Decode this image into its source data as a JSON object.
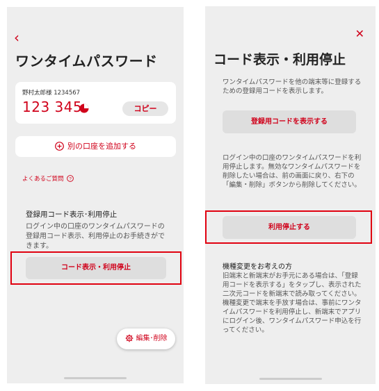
{
  "left": {
    "title": "ワンタイムパスワード",
    "account_name": "野村太郎様 1234567",
    "otp_code": "123 345",
    "copy_label": "コピー",
    "add_account_label": "別の口座を追加する",
    "faq_label": "よくあるご質問",
    "section_title": "登録用コード表示･利用停止",
    "section_desc": "ログイン中の口座のワンタイムパスワードの登録用コード表示、利用停止のお手続きができます。",
    "code_stop_button": "コード表示・利用停止",
    "edit_delete_label": "編集･削除"
  },
  "right": {
    "title": "コード表示・利用停止",
    "desc1": "ワンタイムパスワードを他の端末等に登録するための登録用コードを表示します。",
    "show_code_button": "登録用コードを表示する",
    "desc2": "ログイン中の口座のワンタイムパスワードを利用停止します。無効なワンタイムパスワードを削除したい場合は、前の画面に戻り、右下の「編集・削除」ボタンから削除してください。",
    "stop_button": "利用停止する",
    "section_title": "機種変更をお考えの方",
    "desc3": "旧端末と新端末がお手元にある場合は、「登録用コードを表示する」をタップし、表示された二次元コードを新端末で読み取ってください。機種変更で端末を手放す場合は、事前にワンタイムパスワードを利用停止し、新端末でアプリにログイン後、ワンタイムパスワード申込を行ってください。"
  },
  "icons": {
    "back": "chevron-left-icon",
    "timer": "timer-icon",
    "add": "plus-circle-icon",
    "help": "question-circle-icon",
    "settings": "gear-icon",
    "close": "close-icon"
  },
  "colors": {
    "accent": "#d0021b",
    "highlight_frame": "#e0000f",
    "background": "#eeeeee"
  }
}
